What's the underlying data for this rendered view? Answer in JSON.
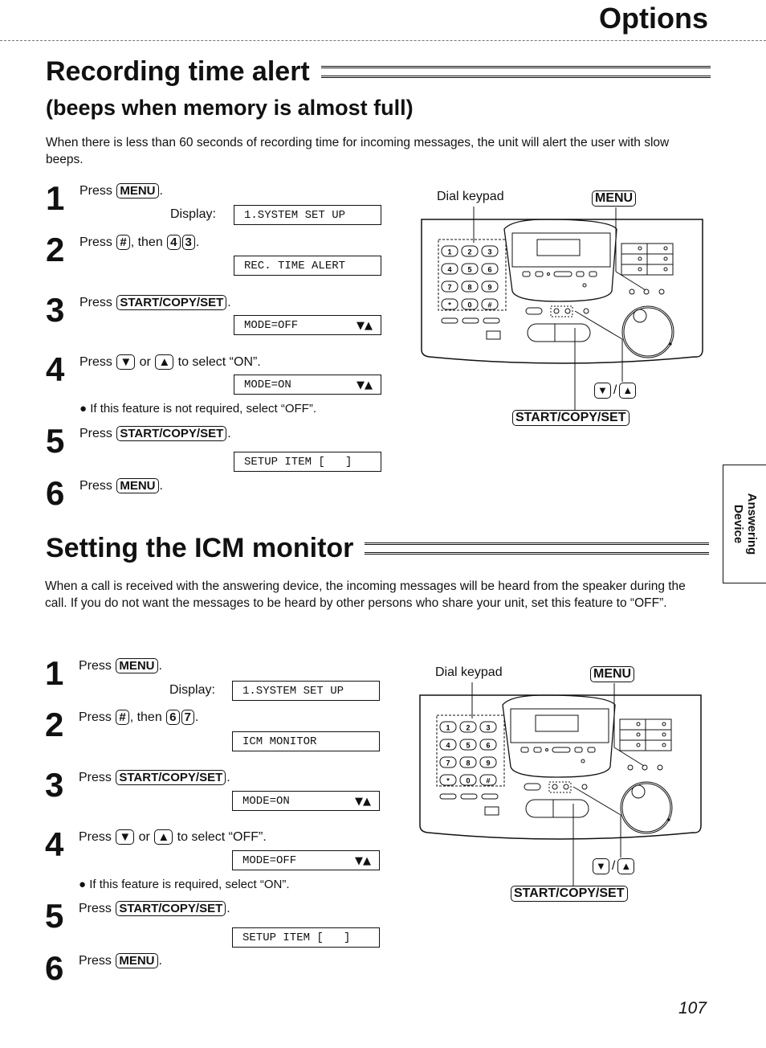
{
  "header": {
    "title": "Options"
  },
  "sections": [
    {
      "title": "Recording time alert",
      "subtitle": "(beeps when memory is almost full)",
      "intro": "When there is less than 60 seconds of recording time for incoming messages, the unit will alert the user with slow beeps.",
      "display_label": "Display:",
      "steps": [
        {
          "num": "1",
          "tokens": [
            {
              "t": "Press "
            },
            {
              "k": "MENU"
            },
            {
              "t": "."
            }
          ],
          "display": "1.SYSTEM SET UP"
        },
        {
          "num": "2",
          "tokens": [
            {
              "t": "Press "
            },
            {
              "k": "#"
            },
            {
              "t": ", then "
            },
            {
              "k": "4"
            },
            {
              "k": "3"
            },
            {
              "t": "."
            }
          ],
          "display": "REC. TIME ALERT"
        },
        {
          "num": "3",
          "tokens": [
            {
              "t": "Press "
            },
            {
              "k": "START/COPY/SET"
            },
            {
              "t": "."
            }
          ],
          "display": "MODE=OFF",
          "arrows": "▼▲"
        },
        {
          "num": "4",
          "tokens": [
            {
              "t": "Press "
            },
            {
              "k": "▼"
            },
            {
              "t": " or "
            },
            {
              "k": "▲"
            },
            {
              "t": " to select “ON”."
            }
          ],
          "display": "MODE=ON",
          "arrows": "▼▲"
        },
        {
          "num": "5",
          "tokens": [
            {
              "t": "Press "
            },
            {
              "k": "START/COPY/SET"
            },
            {
              "t": "."
            }
          ],
          "display": "SETUP ITEM [   ]"
        },
        {
          "num": "6",
          "tokens": [
            {
              "t": "Press "
            },
            {
              "k": "MENU"
            },
            {
              "t": "."
            }
          ]
        }
      ],
      "note": "● If this feature is not required, select “OFF”.",
      "device": {
        "dial_keypad": "Dial keypad",
        "menu": "MENU",
        "down": "▼",
        "up": "▲",
        "sep": "/",
        "start": "START/COPY/SET"
      }
    },
    {
      "title": "Setting the ICM monitor",
      "intro": "When a call is received with the answering device, the incoming messages will be heard from the speaker during the call. If you do not want the messages to be heard by other persons who share your unit, set this feature to “OFF”.",
      "display_label": "Display:",
      "steps": [
        {
          "num": "1",
          "tokens": [
            {
              "t": "Press "
            },
            {
              "k": "MENU"
            },
            {
              "t": "."
            }
          ],
          "display": "1.SYSTEM SET UP"
        },
        {
          "num": "2",
          "tokens": [
            {
              "t": "Press "
            },
            {
              "k": "#"
            },
            {
              "t": ", then "
            },
            {
              "k": "6"
            },
            {
              "k": "7"
            },
            {
              "t": "."
            }
          ],
          "display": "ICM MONITOR"
        },
        {
          "num": "3",
          "tokens": [
            {
              "t": "Press "
            },
            {
              "k": "START/COPY/SET"
            },
            {
              "t": "."
            }
          ],
          "display": "MODE=ON",
          "arrows": "▼▲"
        },
        {
          "num": "4",
          "tokens": [
            {
              "t": "Press "
            },
            {
              "k": "▼"
            },
            {
              "t": " or "
            },
            {
              "k": "▲"
            },
            {
              "t": " to select “OFF”."
            }
          ],
          "display": "MODE=OFF",
          "arrows": "▼▲"
        },
        {
          "num": "5",
          "tokens": [
            {
              "t": "Press "
            },
            {
              "k": "START/COPY/SET"
            },
            {
              "t": "."
            }
          ],
          "display": "SETUP ITEM [   ]"
        },
        {
          "num": "6",
          "tokens": [
            {
              "t": "Press "
            },
            {
              "k": "MENU"
            },
            {
              "t": "."
            }
          ]
        }
      ],
      "note": "● If this feature is required, select “ON”.",
      "device": {
        "dial_keypad": "Dial keypad",
        "menu": "MENU",
        "down": "▼",
        "up": "▲",
        "sep": "/",
        "start": "START/COPY/SET"
      }
    }
  ],
  "side_tab": {
    "line1": "Answering",
    "line2": "Device"
  },
  "page_number": "107"
}
